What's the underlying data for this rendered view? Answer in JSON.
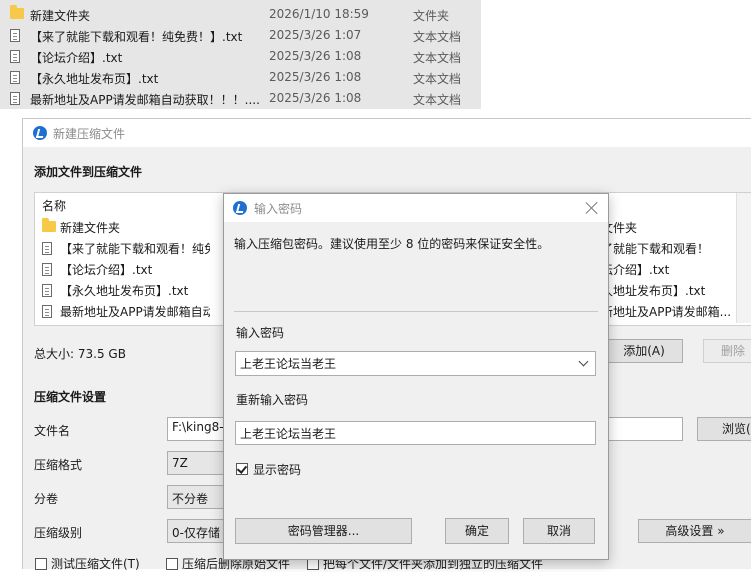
{
  "explorer": {
    "rows": [
      {
        "name": "新建文件夹",
        "date": "2026/1/10 18:59",
        "type": "文件夹",
        "icon": "folder-icon"
      },
      {
        "name": "【来了就能下载和观看！纯免费！】.txt",
        "date": "2025/3/26 1:07",
        "type": "文本文档",
        "icon": "text-file-icon"
      },
      {
        "name": "【论坛介绍】.txt",
        "date": "2025/3/26 1:08",
        "type": "文本文档",
        "icon": "text-file-icon"
      },
      {
        "name": "【永久地址发布页】.txt",
        "date": "2025/3/26 1:08",
        "type": "文本文档",
        "icon": "text-file-icon"
      },
      {
        "name": "最新地址及APP请发邮箱自动获取！！！....",
        "date": "2025/3/26 1:08",
        "type": "文本文档",
        "icon": "text-file-icon"
      }
    ]
  },
  "main_window": {
    "title": "新建压缩文件",
    "add_section_title": "添加文件到压缩文件",
    "list_header": "名称",
    "files": [
      {
        "name": "新建文件夹",
        "icon": "folder-icon"
      },
      {
        "name": "【来了就能下载和观看！纯免费",
        "icon": "text-file-icon"
      },
      {
        "name": "【论坛介绍】.txt",
        "icon": "text-file-icon"
      },
      {
        "name": "【永久地址发布页】.txt",
        "icon": "text-file-icon"
      },
      {
        "name": "最新地址及APP请发邮箱自动获",
        "icon": "text-file-icon"
      }
    ],
    "files_right": [
      "文件夹",
      "了就能下载和观看！",
      "坛介绍】.txt",
      "久地址发布页】.txt",
      "新地址及APP请发邮箱..."
    ],
    "total_size": "总大小: 73.5 GB",
    "add_button": "添加(A)",
    "delete_button": "删除",
    "settings_title": "压缩文件设置",
    "filename_label": "文件名",
    "filename_value": "F:\\king8-",
    "browse_button": "浏览(",
    "format_label": "压缩格式",
    "format_value": "7Z",
    "split_label": "分卷",
    "split_value": "不分卷",
    "level_label": "压缩级别",
    "level_value": "0-仅存储",
    "advanced_button": "高级设置 »",
    "opt_test": "测试压缩文件(T)",
    "opt_delete_source": "压缩后删除原始文件",
    "opt_each_file": "把每个文件/文件夹添加到独立的压缩文件"
  },
  "pwd_dialog": {
    "title": "输入密码",
    "description": "输入压缩包密码。建议使用至少 8 位的密码来保证安全性。",
    "password_label": "输入密码",
    "password_value": "上老王论坛当老王",
    "reenter_label": "重新输入密码",
    "reenter_value": "上老王论坛当老王",
    "show_password_label": "显示密码",
    "show_password_checked": true,
    "manager_button": "密码管理器...",
    "ok_button": "确定",
    "cancel_button": "取消"
  },
  "colors": {
    "accent": "#1f6fd1",
    "folder": "#f7c948",
    "dialog_bg": "#f0f0f0",
    "explorer_bg": "#e6e6e6"
  }
}
